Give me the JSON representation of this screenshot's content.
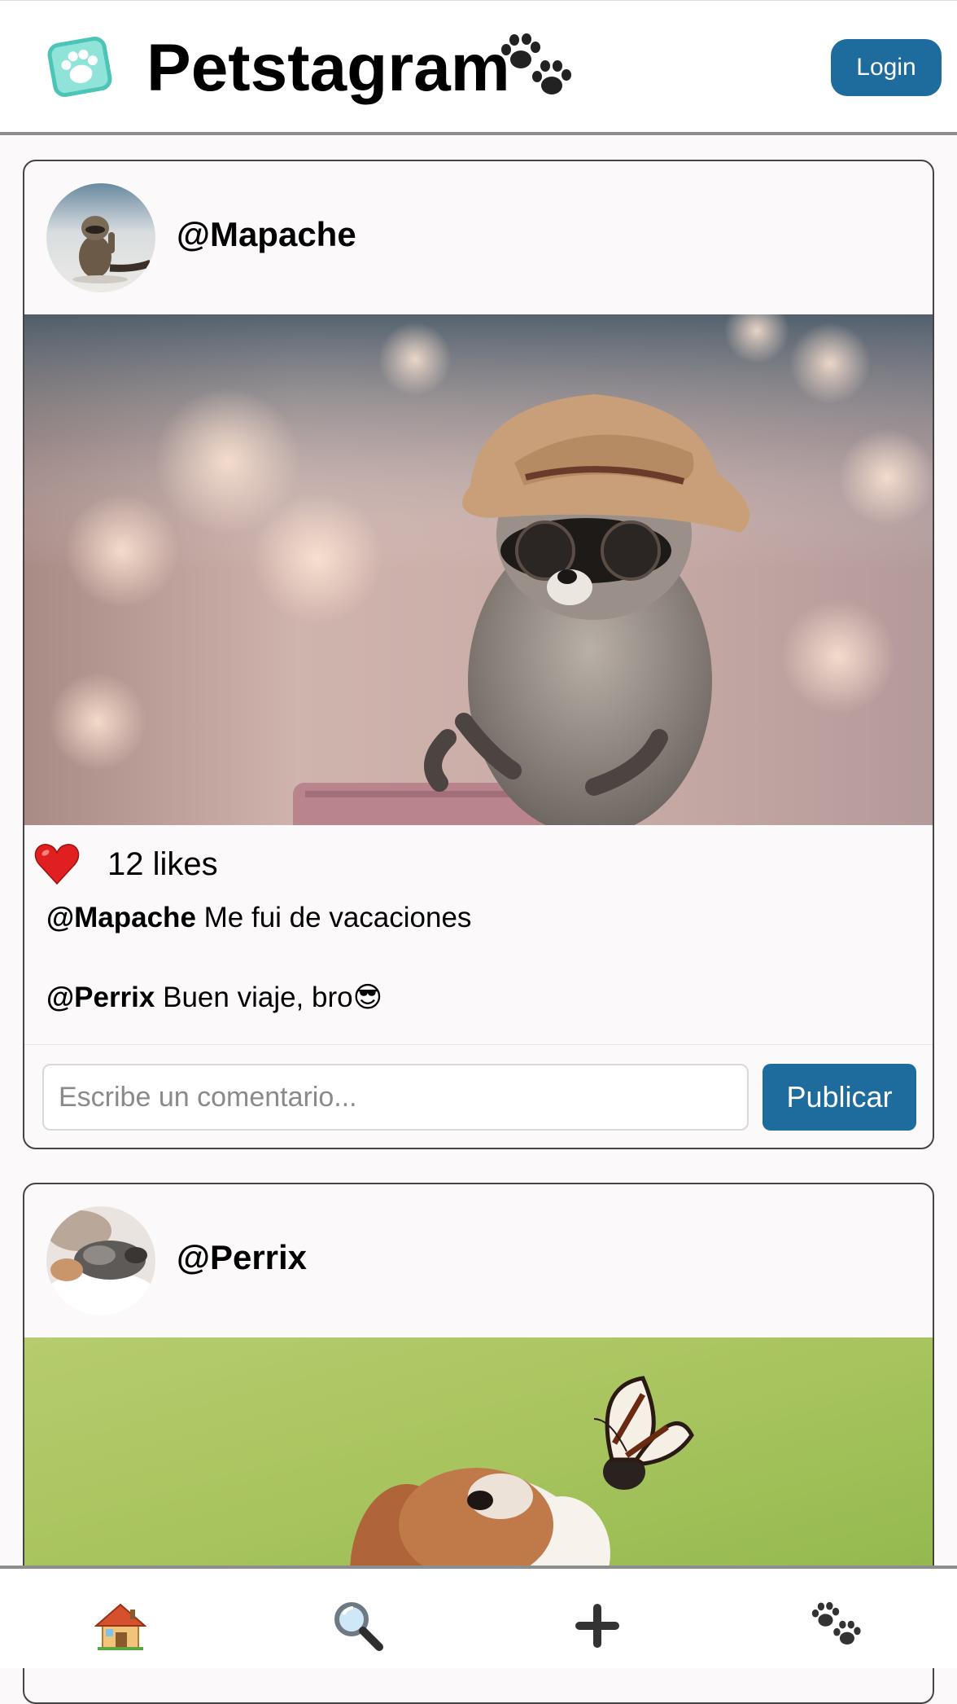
{
  "header": {
    "app_title": "Petstagram",
    "login_label": "Login"
  },
  "posts": [
    {
      "username": "@Mapache",
      "likes": "12 likes",
      "comments": [
        {
          "user": "@Mapache",
          "text": "Me fui de vacaciones"
        },
        {
          "user": "@Perrix",
          "text": "Buen viaje, bro😎"
        }
      ],
      "comment_placeholder": "Escribe un comentario...",
      "publish_label": "Publicar"
    },
    {
      "username": "@Perrix"
    }
  ],
  "nav": {
    "items": [
      {
        "name": "home-icon",
        "glyph": "🏠"
      },
      {
        "name": "search-icon",
        "glyph": "🔍"
      },
      {
        "name": "add-icon",
        "glyph": "+"
      },
      {
        "name": "paw-icon",
        "glyph": "🐾"
      }
    ]
  },
  "colors": {
    "accent": "#1e6b9e",
    "logo_teal": "#5ed5c8",
    "heart": "#e02020"
  }
}
